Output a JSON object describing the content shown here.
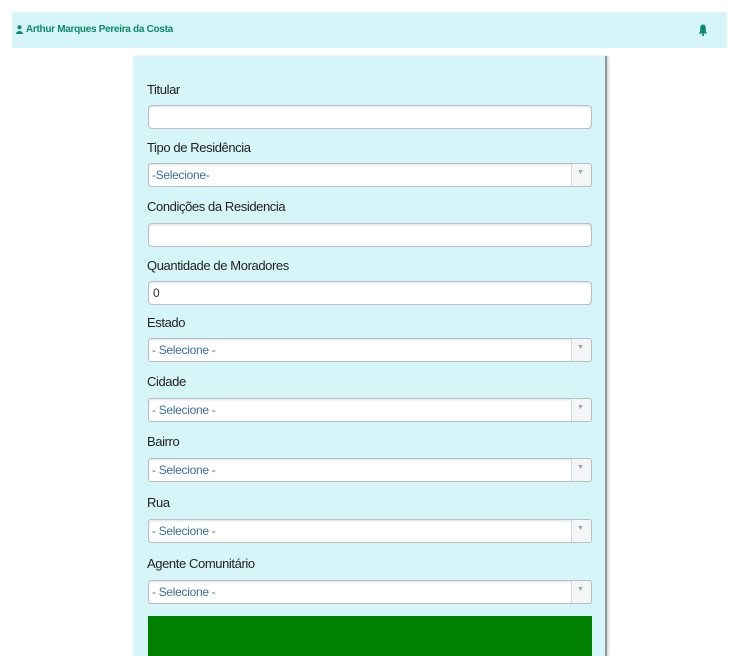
{
  "header": {
    "user_name": "Arthur Marques Pereira da Costa",
    "user_icon": "user-icon",
    "bell_icon": "bell-icon",
    "accent_color": "#0a8a6a",
    "background_color": "#d6f5f8"
  },
  "form": {
    "titular": {
      "label": "Titular",
      "value": ""
    },
    "tipo_residencia": {
      "label": "Tipo de Residência",
      "selected": "-Selecione-"
    },
    "condicoes_residencia": {
      "label": "Condições da Residencia",
      "value": ""
    },
    "quantidade_moradores": {
      "label": "Quantidade de Moradores",
      "value": "0"
    },
    "estado": {
      "label": "Estado",
      "selected": "- Selecione -"
    },
    "cidade": {
      "label": "Cidade",
      "selected": "- Selecione -"
    },
    "bairro": {
      "label": "Bairro",
      "selected": "- Selecione -"
    },
    "rua": {
      "label": "Rua",
      "selected": "- Selecione -"
    },
    "agente_comunitario": {
      "label": "Agente Comunitário",
      "selected": "- Selecione -"
    },
    "submit_color": "#008000",
    "dropdown_arrow_icon": "chevron-down-icon"
  }
}
